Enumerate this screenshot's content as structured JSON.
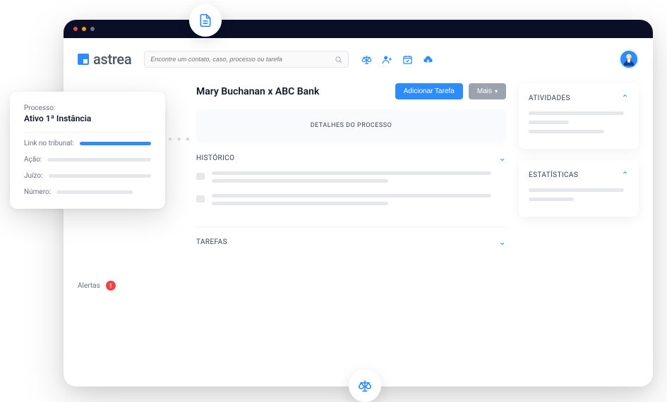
{
  "brand": {
    "name": "astrea"
  },
  "search": {
    "placeholder": "Encontre um contato, caso, processo ou tarefa"
  },
  "sidebar": {
    "alerts_label": "Alertas",
    "alerts_count": "1"
  },
  "case": {
    "title": "Mary Buchanan x ABC Bank",
    "add_task_label": "Adicionar Tarefa",
    "more_label": "Mais",
    "details_panel": "DETALHES DO PROCESSO",
    "history_label": "HISTÓRICO",
    "tasks_label": "TAREFAS"
  },
  "right": {
    "activities_label": "ATIVIDADES",
    "stats_label": "ESTATÍSTICAS"
  },
  "popup": {
    "process_label": "Processo:",
    "process_value": "Ativo 1ª Instância",
    "link_label": "Link no tribunal:",
    "action_label": "Ação:",
    "court_label": "Juízo:",
    "number_label": "Número:"
  }
}
